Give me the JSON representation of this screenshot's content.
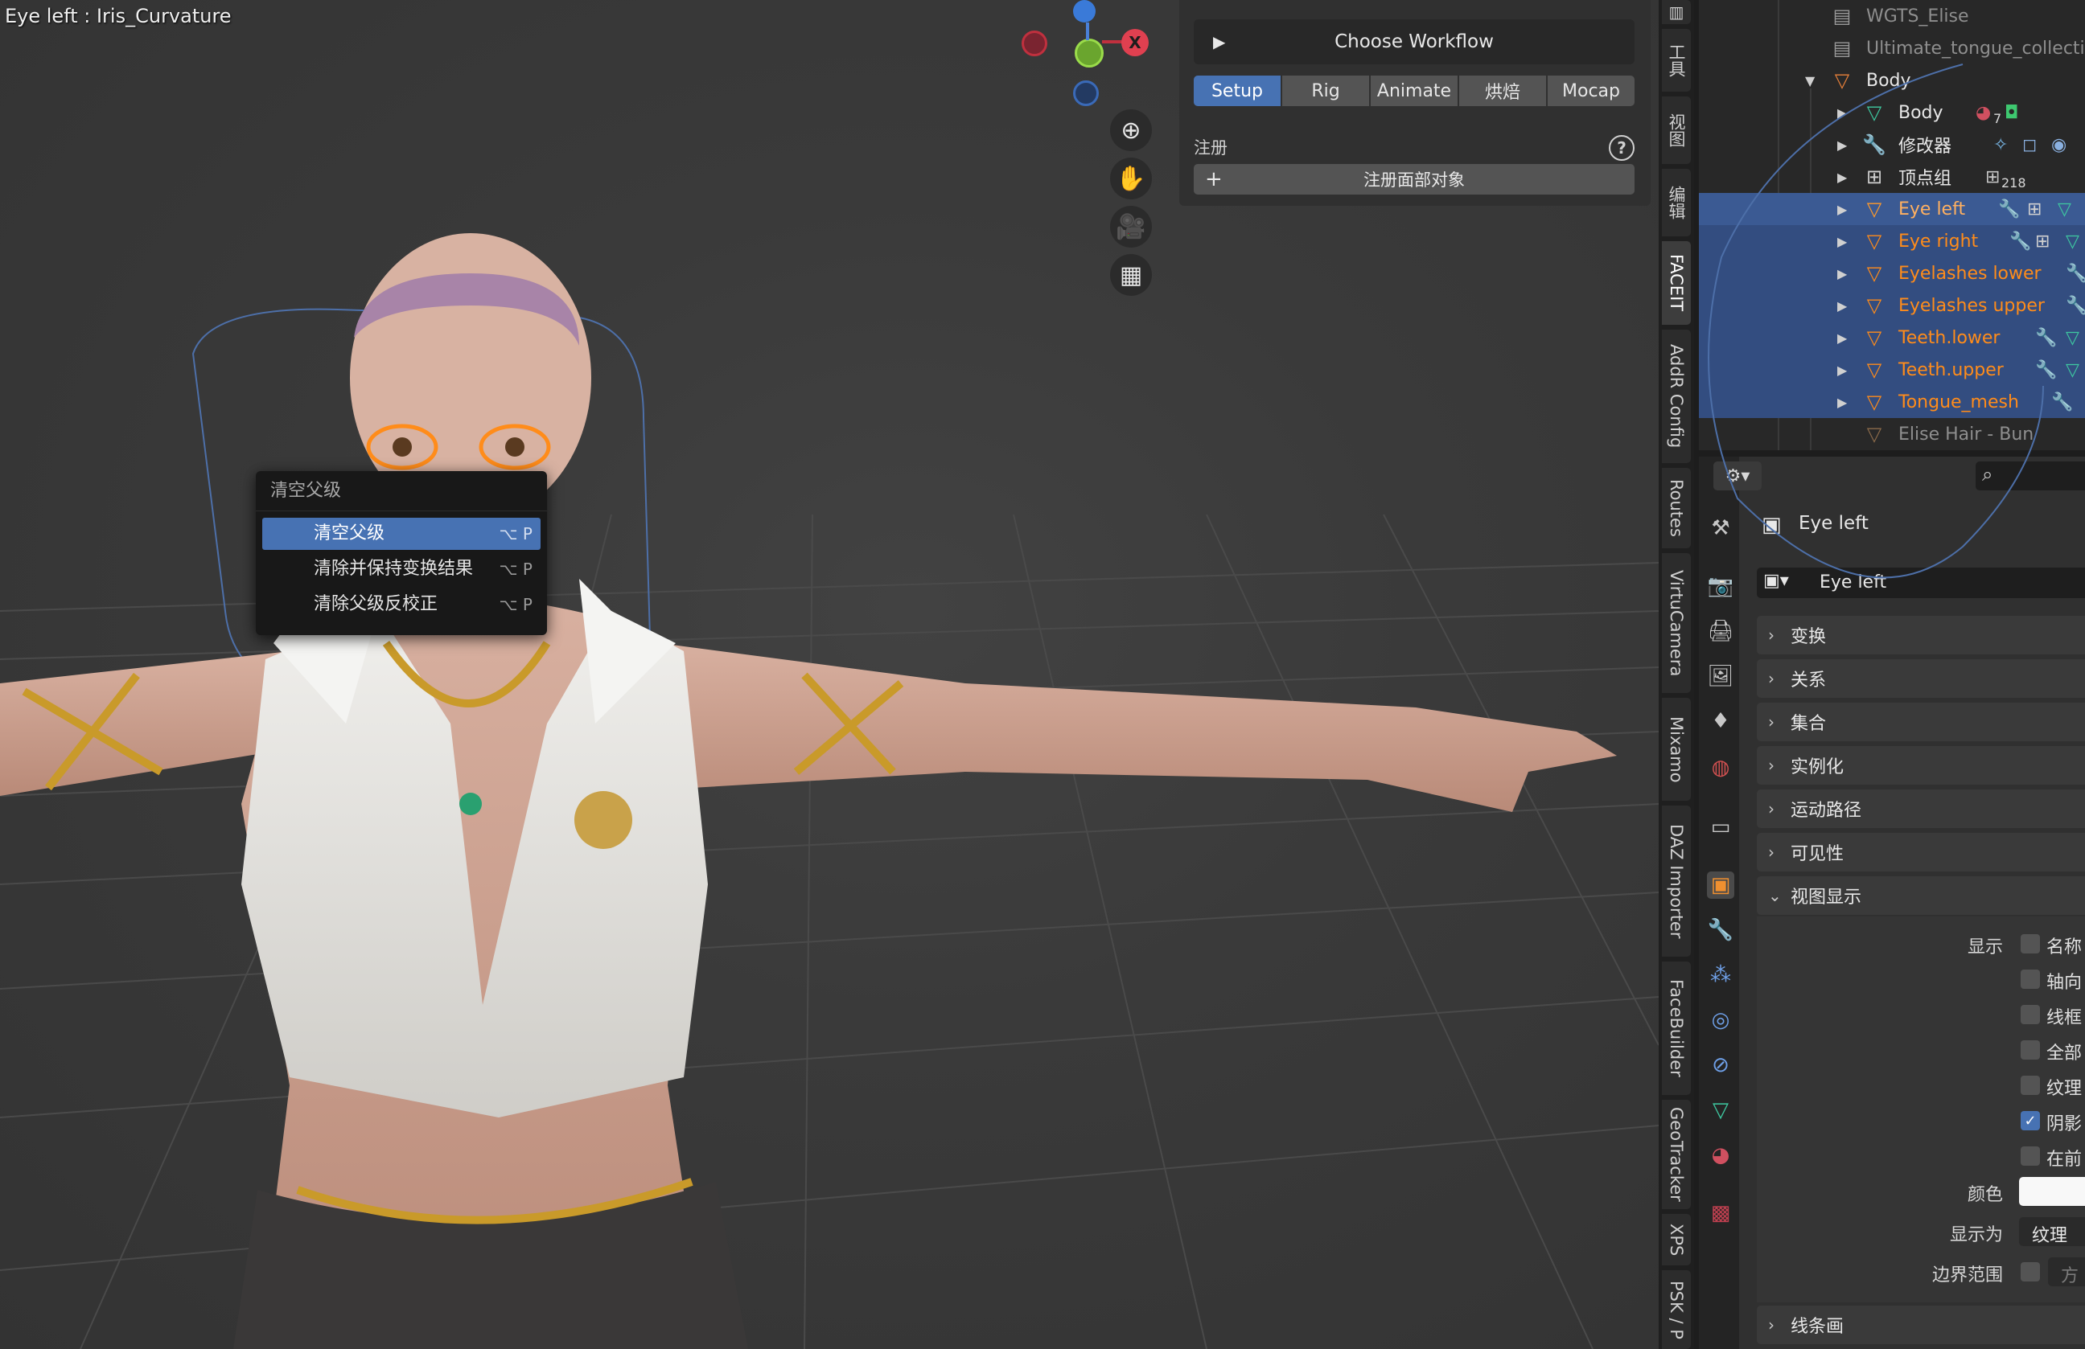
{
  "viewport": {
    "title": "Eye left : Iris_Curvature",
    "gizmo": {
      "x_label": "X"
    },
    "nav_icons": [
      "zoom-in-icon",
      "hand-pan-icon",
      "camera-icon",
      "perspective-grid-icon"
    ]
  },
  "context_menu": {
    "title": "清空父级",
    "items": [
      {
        "label": "清空父级",
        "shortcut": "⌥ P",
        "active": true
      },
      {
        "label": "清除并保持变换结果",
        "shortcut": "⌥ P",
        "active": false
      },
      {
        "label": "清除父级反校正",
        "shortcut": "⌥ P",
        "active": false
      }
    ]
  },
  "workflow": {
    "choose_label": "Choose Workflow",
    "tabs": [
      "Setup",
      "Rig",
      "Animate",
      "烘焙",
      "Mocap"
    ],
    "active_tab": "Setup",
    "register_label": "注册",
    "register_button": "注册面部对象",
    "help": "?"
  },
  "tabstrip": [
    "工具",
    "视图",
    "编辑",
    "FACEIT",
    "AddR Config",
    "Routes",
    "VirtuCamera",
    "Mixamo",
    "DAZ Importer",
    "FaceBuilder",
    "GeoTracker",
    "XPS",
    "PSK / P"
  ],
  "tabstrip_active": "FACEIT",
  "outliner": {
    "rows": [
      {
        "label": "WGTS_Elise",
        "type": "collection",
        "indent": 0,
        "state": "dim"
      },
      {
        "label": "Ultimate_tongue_collectio",
        "type": "collection",
        "indent": 0,
        "state": "dim"
      },
      {
        "label": "Body",
        "type": "object",
        "indent": 0,
        "state": "normal",
        "expanded": true
      },
      {
        "label": "Body",
        "type": "mesh",
        "indent": 1,
        "state": "normal",
        "ext": "7"
      },
      {
        "label": "修改器",
        "type": "modifier",
        "indent": 1,
        "state": "normal"
      },
      {
        "label": "顶点组",
        "type": "vgroup",
        "indent": 1,
        "state": "normal",
        "ext": "218"
      },
      {
        "label": "Eye left",
        "type": "object",
        "indent": 1,
        "state": "active"
      },
      {
        "label": "Eye right",
        "type": "object",
        "indent": 1,
        "state": "selected"
      },
      {
        "label": "Eyelashes lower",
        "type": "object",
        "indent": 1,
        "state": "selected"
      },
      {
        "label": "Eyelashes upper",
        "type": "object",
        "indent": 1,
        "state": "selected"
      },
      {
        "label": "Teeth.lower",
        "type": "object",
        "indent": 1,
        "state": "selected"
      },
      {
        "label": "Teeth.upper",
        "type": "object",
        "indent": 1,
        "state": "selected"
      },
      {
        "label": "Tongue_mesh",
        "type": "object",
        "indent": 1,
        "state": "selected"
      },
      {
        "label": "Elise Hair - Bun",
        "type": "object",
        "indent": 1,
        "state": "dim"
      }
    ]
  },
  "properties": {
    "object_name": "Eye left",
    "datablock_name": "Eye left",
    "panels": [
      "变换",
      "关系",
      "集合",
      "实例化",
      "运动路径",
      "可见性"
    ],
    "open_panel": "视图显示",
    "display_label": "显示",
    "display_options": [
      {
        "label": "名称",
        "checked": false
      },
      {
        "label": "轴向",
        "checked": false
      },
      {
        "label": "线框",
        "checked": false
      },
      {
        "label": "全部",
        "checked": false
      },
      {
        "label": "纹理",
        "checked": false
      },
      {
        "label": "阴影",
        "checked": true
      },
      {
        "label": "在前",
        "checked": false
      }
    ],
    "color_label": "颜色",
    "display_as_label": "显示为",
    "display_as_value": "纹理",
    "bounds_label": "边界范围",
    "bounds_value": "方",
    "bottom_panel": "线条画"
  },
  "colors": {
    "accent": "#4772b3",
    "selection_orange": "#ff8c1a",
    "outliner_selected": "#334d80",
    "axis_x": "#e04050",
    "axis_y": "#7cc43a",
    "axis_z": "#3a7ad8"
  }
}
